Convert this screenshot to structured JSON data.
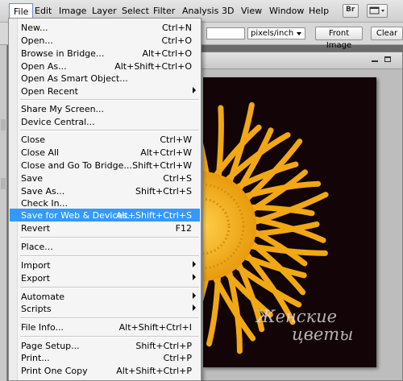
{
  "menubar": {
    "items": [
      "File",
      "Edit",
      "Image",
      "Layer",
      "Select",
      "Filter",
      "Analysis",
      "3D",
      "View",
      "Window",
      "Help"
    ],
    "bridge_label": "Br"
  },
  "options": {
    "resolution_unit": "pixels/inch",
    "front_image_label": "Front Image",
    "clear_label": "Clear"
  },
  "file_menu": {
    "items": [
      {
        "label": "New...",
        "shortcut": "Ctrl+N"
      },
      {
        "label": "Open...",
        "shortcut": "Ctrl+O"
      },
      {
        "label": "Browse in Bridge...",
        "shortcut": "Alt+Ctrl+O"
      },
      {
        "label": "Open As...",
        "shortcut": "Alt+Shift+Ctrl+O"
      },
      {
        "label": "Open As Smart Object...",
        "shortcut": ""
      },
      {
        "label": "Open Recent",
        "shortcut": ""
      },
      {
        "label": "Share My Screen...",
        "shortcut": ""
      },
      {
        "label": "Device Central...",
        "shortcut": ""
      },
      {
        "label": "Close",
        "shortcut": "Ctrl+W"
      },
      {
        "label": "Close All",
        "shortcut": "Alt+Ctrl+W"
      },
      {
        "label": "Close and Go To Bridge...",
        "shortcut": "Shift+Ctrl+W"
      },
      {
        "label": "Save",
        "shortcut": "Ctrl+S"
      },
      {
        "label": "Save As...",
        "shortcut": "Shift+Ctrl+S"
      },
      {
        "label": "Check In...",
        "shortcut": ""
      },
      {
        "label": "Save for Web & Devices...",
        "shortcut": "Alt+Shift+Ctrl+S"
      },
      {
        "label": "Revert",
        "shortcut": "F12"
      },
      {
        "label": "Place...",
        "shortcut": ""
      },
      {
        "label": "Import",
        "shortcut": ""
      },
      {
        "label": "Export",
        "shortcut": ""
      },
      {
        "label": "Automate",
        "shortcut": ""
      },
      {
        "label": "Scripts",
        "shortcut": ""
      },
      {
        "label": "File Info...",
        "shortcut": "Alt+Shift+Ctrl+I"
      },
      {
        "label": "Page Setup...",
        "shortcut": "Shift+Ctrl+P"
      },
      {
        "label": "Print...",
        "shortcut": "Ctrl+P"
      },
      {
        "label": "Print One Copy",
        "shortcut": "Alt+Shift+Ctrl+P"
      }
    ]
  },
  "canvas": {
    "watermark_line1": "Женские",
    "watermark_line2": "цветы"
  },
  "colors": {
    "menu_highlight": "#3399ff",
    "flower_yellow": "#f2a814",
    "canvas_bg": "#120407"
  }
}
